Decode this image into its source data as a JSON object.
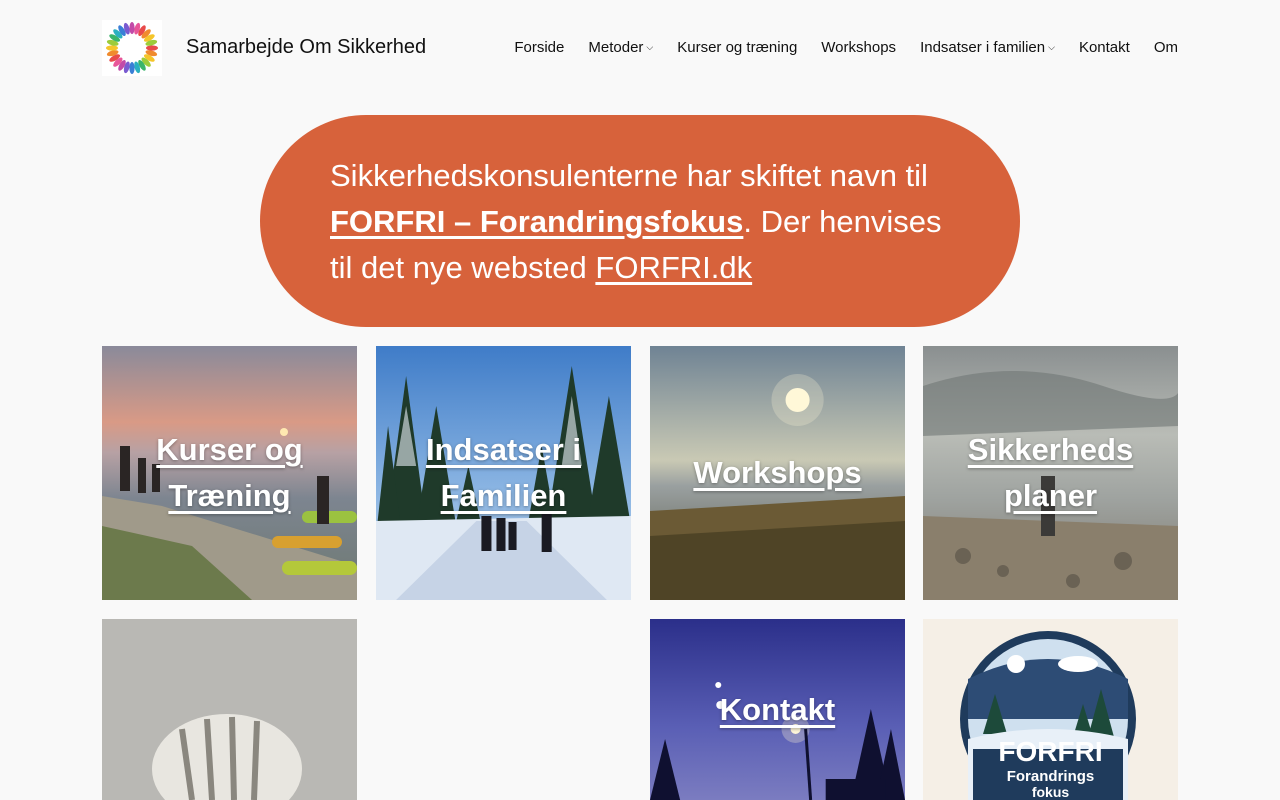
{
  "site": {
    "title": "Samarbejde Om Sikkerhed",
    "logo_text": "Samarbejde om sikkerhed"
  },
  "nav": {
    "items": [
      {
        "label": "Forside",
        "has_submenu": false
      },
      {
        "label": "Metoder",
        "has_submenu": true
      },
      {
        "label": "Kurser og træning",
        "has_submenu": false
      },
      {
        "label": "Workshops",
        "has_submenu": false
      },
      {
        "label": "Indsatser i familien",
        "has_submenu": true
      },
      {
        "label": "Kontakt",
        "has_submenu": false
      },
      {
        "label": "Om",
        "has_submenu": false
      }
    ],
    "submenu_glyph": "⌵"
  },
  "banner": {
    "text_before": "Sikkerhedskonsulenterne har skiftet navn til",
    "link_forfri": "FORFRI – Forandringsfokus",
    "text_middle": ". Der henvises til det nye websted",
    "link_site": "FORFRI.dk",
    "color": "#d7623b"
  },
  "tiles": [
    {
      "label_line1": "Kurser og",
      "label_line2": "Træning"
    },
    {
      "label_line1": "Indsatser i",
      "label_line2": "Familien"
    },
    {
      "label_line1": "Workshops",
      "label_line2": ""
    },
    {
      "label_line1": "Sikkerheds",
      "label_line2": "planer"
    },
    {
      "label_line1": "",
      "label_line2": ""
    },
    {
      "label_line1": "Kontakt",
      "label_line2": ""
    },
    {
      "logo_word": "FORFRI",
      "logo_sub1": "Forandrings",
      "logo_sub2": "fokus"
    }
  ]
}
